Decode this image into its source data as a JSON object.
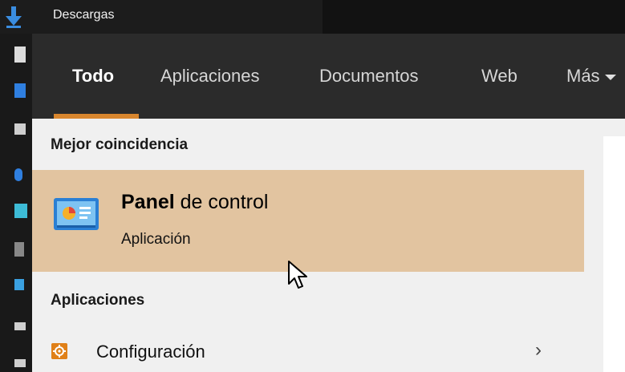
{
  "explorer": {
    "title": "Descargas"
  },
  "tabs": [
    {
      "label": "Todo",
      "active": true
    },
    {
      "label": "Aplicaciones",
      "active": false
    },
    {
      "label": "Documentos",
      "active": false
    },
    {
      "label": "Web",
      "active": false
    },
    {
      "label": "Más",
      "active": false
    }
  ],
  "best_match": {
    "heading": "Mejor coincidencia",
    "title_bold": "Panel",
    "title_rest": " de control",
    "subtitle": "Aplicación",
    "icon": "control-panel-icon"
  },
  "apps": {
    "heading": "Aplicaciones",
    "items": [
      {
        "label": "Configuración",
        "icon": "gear-icon",
        "chevron": "›"
      }
    ]
  },
  "colors": {
    "accent": "#d8862e",
    "highlight": "#e2c4a0",
    "tabbar": "#2b2b2b",
    "panel": "#f0f0f0"
  }
}
